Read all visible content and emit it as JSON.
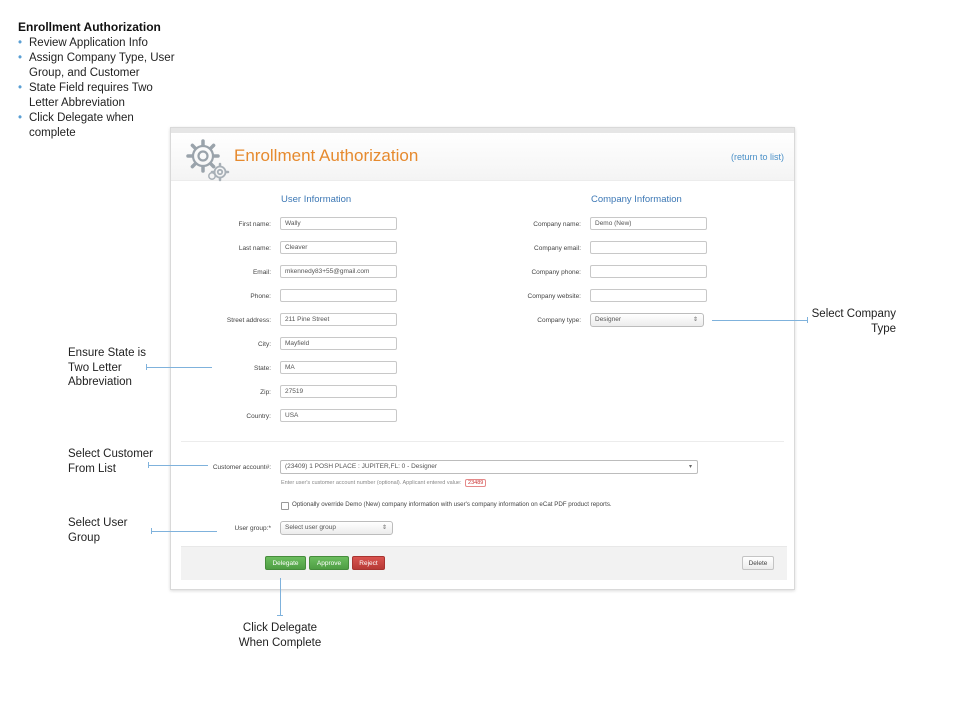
{
  "instructions": {
    "title": "Enrollment Authorization",
    "steps": [
      "Review Application Info",
      "Assign Company Type, User Group, and Customer",
      "State Field requires Two Letter Abbreviation",
      "Click Delegate when complete"
    ]
  },
  "app": {
    "title": "Enrollment Authorization",
    "return_link": "(return to list)"
  },
  "user_info": {
    "section_title": "User Information",
    "fields": [
      {
        "label": "First name:",
        "value": "Wally"
      },
      {
        "label": "Last name:",
        "value": "Cleaver"
      },
      {
        "label": "Email:",
        "value": "mkennedy83+55@gmail.com"
      },
      {
        "label": "Phone:",
        "value": ""
      },
      {
        "label": "Street address:",
        "value": "211 Pine Street"
      },
      {
        "label": "City:",
        "value": "Mayfield"
      },
      {
        "label": "State:",
        "value": "MA"
      },
      {
        "label": "Zip:",
        "value": "27519"
      },
      {
        "label": "Country:",
        "value": "USA"
      }
    ]
  },
  "company_info": {
    "section_title": "Company Information",
    "fields": [
      {
        "label": "Company name:",
        "value": "Demo (New)"
      },
      {
        "label": "Company email:",
        "value": ""
      },
      {
        "label": "Company phone:",
        "value": ""
      },
      {
        "label": "Company website:",
        "value": ""
      }
    ],
    "type_label": "Company type:",
    "type_value": "Designer"
  },
  "customer": {
    "label": "Customer account#:",
    "value": "(23409) 1 POSH PLACE : JUPITER,FL: 0 - Designer",
    "help": "Enter user's customer account number (optional). Applicant entered value:",
    "entered_value": "23489"
  },
  "override": {
    "text": "Optionally override Demo (New) company information with user's company information on eCat PDF product reports."
  },
  "user_group": {
    "label": "User group:*",
    "placeholder": "Select user group"
  },
  "buttons": {
    "delegate": "Delegate",
    "approve": "Approve",
    "reject": "Reject",
    "delete": "Delete"
  },
  "annotations": {
    "company_type": "Select Company Type",
    "state": "Ensure State is Two Letter Abbreviation",
    "customer": "Select Customer From List",
    "user_group": "Select User Group",
    "delegate": "Click Delegate When Complete"
  },
  "colors": {
    "title_orange": "#e68a2e",
    "section_blue": "#3d78b5",
    "button_green": "#5cb050",
    "button_red": "#c9403c",
    "annotation_line": "#7fb2dc"
  },
  "icons": {
    "app_logo": "gears-icon",
    "select_arrows": "chevron-updown-icon"
  }
}
